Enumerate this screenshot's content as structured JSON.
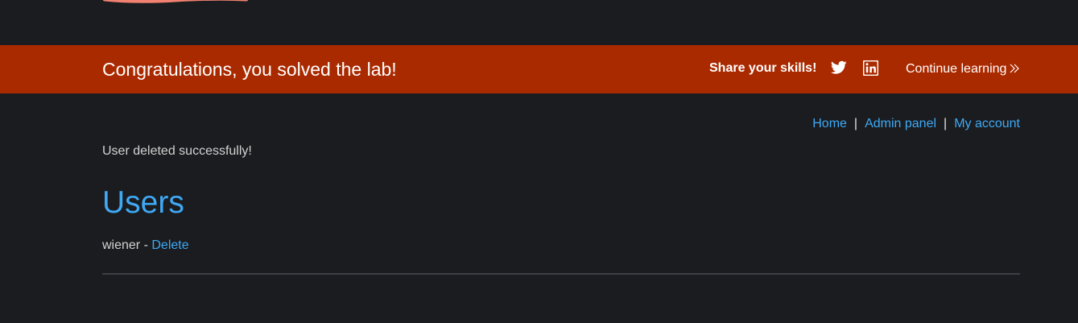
{
  "banner": {
    "title": "Congratulations, you solved the lab!",
    "share_label": "Share your skills!",
    "twitter_icon": "twitter-icon",
    "linkedin_icon": "linkedin-icon",
    "continue_label": "Continue learning",
    "background_color": "#aa2a00"
  },
  "nav": {
    "items": [
      "Home",
      "Admin panel",
      "My account"
    ],
    "separator": "|"
  },
  "status_message": "User deleted successfully!",
  "users": {
    "heading": "Users",
    "list": [
      {
        "name": "wiener",
        "separator": " - ",
        "action": "Delete"
      }
    ]
  },
  "colors": {
    "background": "#1a1c1f",
    "link": "#3fa9f5",
    "text": "#d2d2d2"
  }
}
